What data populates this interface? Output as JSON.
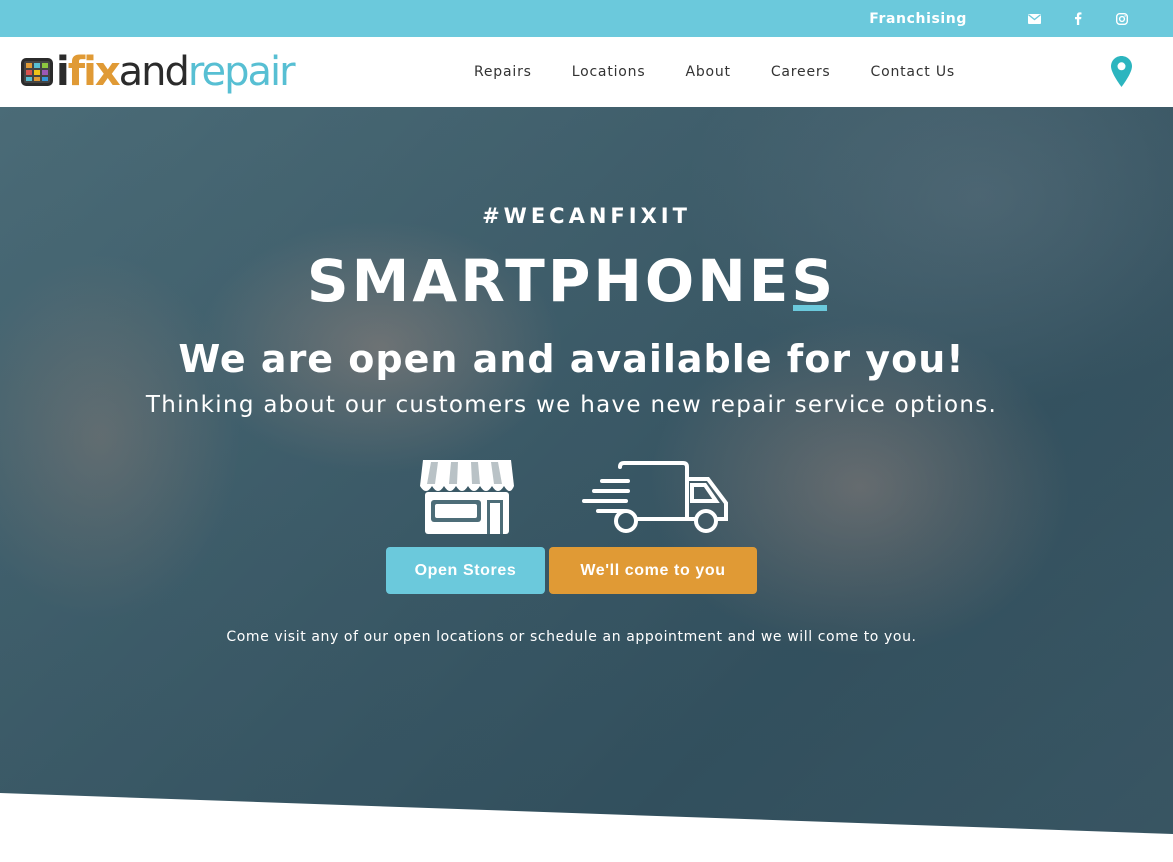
{
  "topbar": {
    "franchising_label": "Franchising",
    "icons": [
      "envelope-icon",
      "facebook-icon",
      "instagram-icon"
    ]
  },
  "header": {
    "logo": {
      "part_i": "i",
      "part_fix": "fix",
      "part_and": "and",
      "part_repair": "repair"
    },
    "nav": [
      {
        "label": "Repairs"
      },
      {
        "label": "Locations"
      },
      {
        "label": "About"
      },
      {
        "label": "Careers"
      },
      {
        "label": "Contact Us"
      }
    ]
  },
  "hero": {
    "tagline": "#WECANFIXIT",
    "headline": "SMARTPHONES",
    "subhead": "We are open and available for you!",
    "subline": "Thinking about our customers we have new repair service options.",
    "buttons": {
      "open_stores": "Open Stores",
      "come_to_you": "We'll come to you"
    },
    "note": "Come visit any of our open locations or schedule an appointment and we will come to you."
  },
  "colors": {
    "accent_teal": "#6bc9dc",
    "accent_orange": "#e09a35",
    "text_dark": "#333333"
  }
}
